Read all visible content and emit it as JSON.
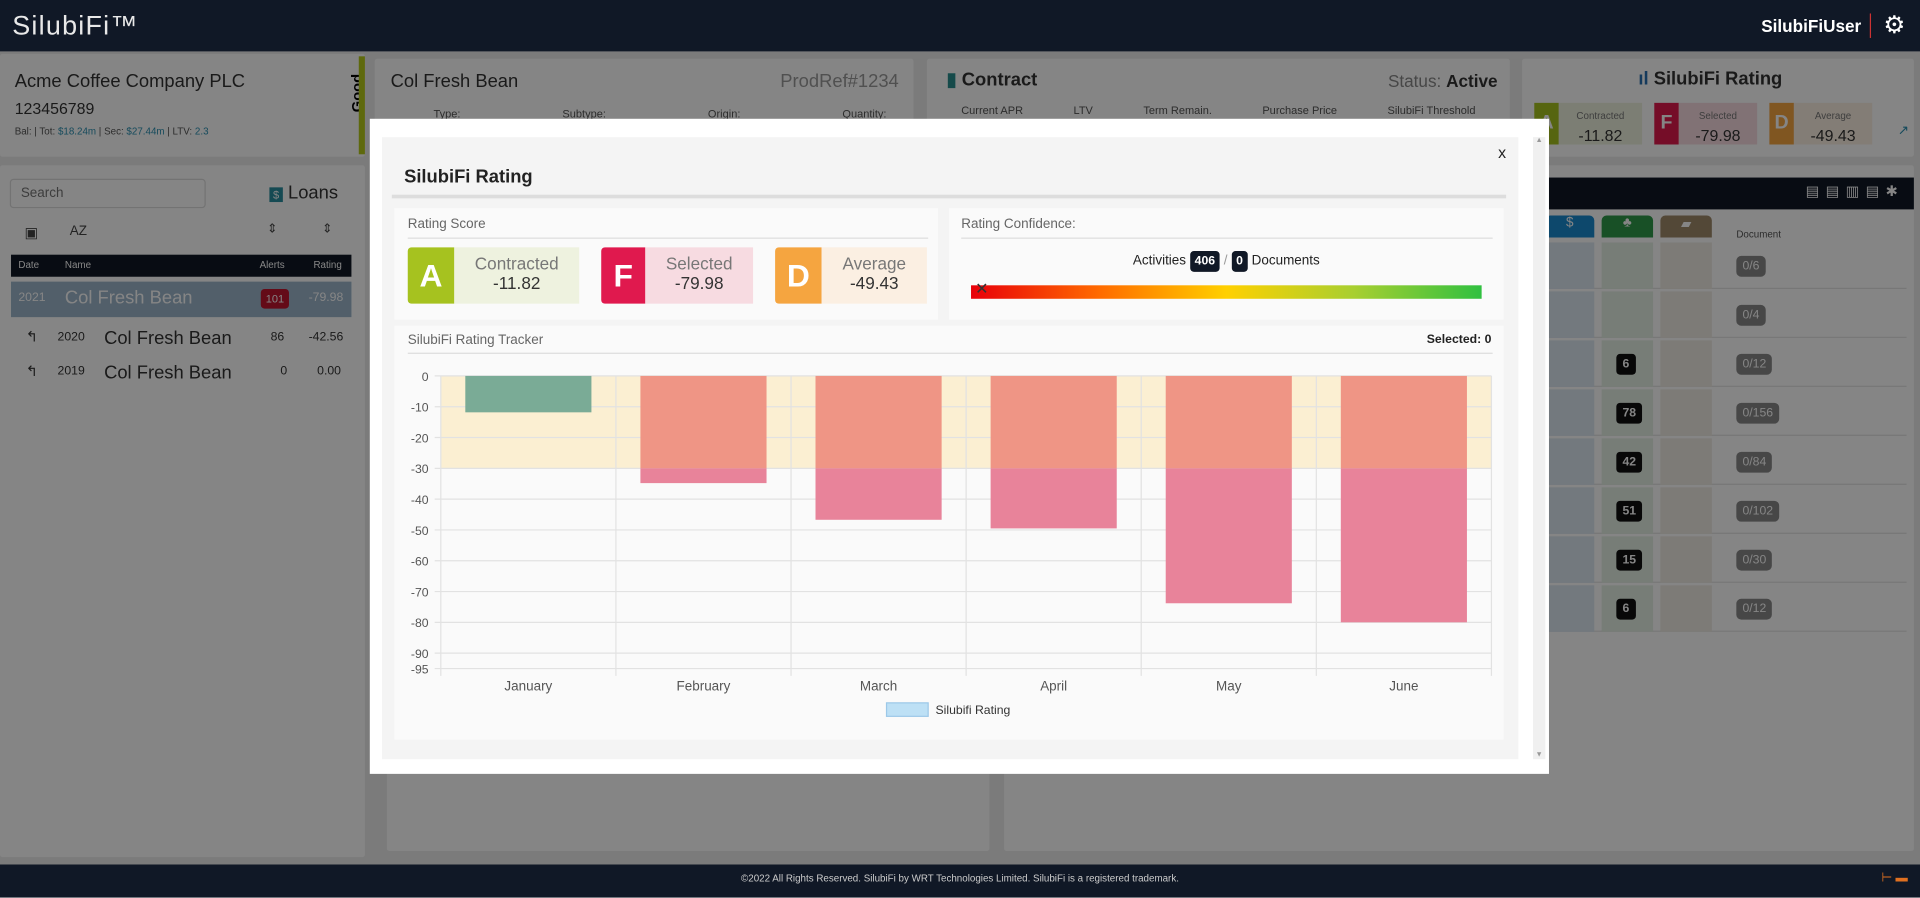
{
  "app": {
    "logo": "SilubiFi™",
    "user": "SilubiFiUser",
    "footer": "©2022 All Rights Reserved. SilubiFi by WRT Technologies Limited. SilubiFi is a registered trademark."
  },
  "company": {
    "name": "Acme Coffee Company PLC",
    "id": "123456789",
    "bal_label": "Bal:",
    "tot_label": "Tot:",
    "tot": "$18.24m",
    "sec_label": "Sec:",
    "sec": "$27.44m",
    "ltv_label": "LTV:",
    "ltv": "2.3",
    "status": "Good"
  },
  "product": {
    "name": "Col Fresh Bean",
    "ref": "ProdRef#1234",
    "cols": [
      "Type:",
      "Subtype:",
      "Origin:",
      "Quantity:"
    ]
  },
  "contract": {
    "title": "Contract",
    "status_label": "Status:",
    "status": "Active",
    "cols": [
      "Current APR",
      "LTV",
      "Term Remain.",
      "Purchase Price",
      "SilubiFi Threshold"
    ]
  },
  "rating_card": {
    "title": "SilubiFi Rating",
    "grades": [
      {
        "letter": "A",
        "label": "Contracted",
        "value": "-11.82"
      },
      {
        "letter": "F",
        "label": "Selected",
        "value": "-79.98"
      },
      {
        "letter": "D",
        "label": "Average",
        "value": "-49.43"
      }
    ]
  },
  "loans": {
    "search_placeholder": "Search",
    "title": "Loans",
    "sort_az": "AZ",
    "headers": [
      "Date",
      "Name",
      "Alerts",
      "Rating"
    ],
    "rows": [
      {
        "date": "2021",
        "name": "Col Fresh Bean",
        "alerts": "101",
        "rating": "-79.98"
      },
      {
        "date": "2020",
        "name": "Col Fresh Bean",
        "alerts": "86",
        "rating": "-42.56"
      },
      {
        "date": "2019",
        "name": "Col Fresh Bean",
        "alerts": "0",
        "rating": "0.00"
      }
    ]
  },
  "table": {
    "doc_header": "Document",
    "badges": [
      "",
      "",
      "6",
      "78",
      "42",
      "51",
      "15",
      "6"
    ],
    "docs": [
      "0/6",
      "0/4",
      "0/12",
      "0/156",
      "0/84",
      "0/102",
      "0/30",
      "0/12"
    ]
  },
  "modal": {
    "title": "SilubiFi Rating",
    "close": "x",
    "score_title": "Rating Score",
    "grades": [
      {
        "letter": "A",
        "label": "Contracted",
        "value": "-11.82",
        "color": "#a6c21f",
        "bg": "#eef2df"
      },
      {
        "letter": "F",
        "label": "Selected",
        "value": "-79.98",
        "color": "#e0194e",
        "bg": "#f7dbe1"
      },
      {
        "letter": "D",
        "label": "Average",
        "value": "-49.43",
        "color": "#f5a540",
        "bg": "#fbefe2"
      }
    ],
    "confidence_title": "Rating Confidence:",
    "activities_label": "Activities",
    "activities": "406",
    "slash": "/",
    "documents": "0",
    "documents_label": "Documents",
    "confidence_level": 0.02,
    "tracker_title": "SilubiFi Rating Tracker",
    "selected_label": "Selected: 0"
  },
  "chart_data": {
    "type": "bar",
    "categories": [
      "January",
      "February",
      "March",
      "April",
      "May",
      "June"
    ],
    "series": [
      {
        "name": "Silubifi Rating",
        "values": [
          -11.82,
          -34.8,
          -46.7,
          -49.5,
          -73.8,
          -79.98
        ]
      }
    ],
    "ylim": [
      -95,
      0
    ],
    "yticks": [
      0,
      -10,
      -20,
      -30,
      -40,
      -50,
      -60,
      -70,
      -80,
      -90,
      -95
    ],
    "threshold_band": [
      -30,
      0
    ],
    "grid": true,
    "legend": "bottom",
    "colors": {
      "good": "#7aab96",
      "band": "#fbefd2",
      "above_threshold": "#ef9585",
      "below_threshold": "#e8839a",
      "legend": "#bde0f5"
    }
  }
}
